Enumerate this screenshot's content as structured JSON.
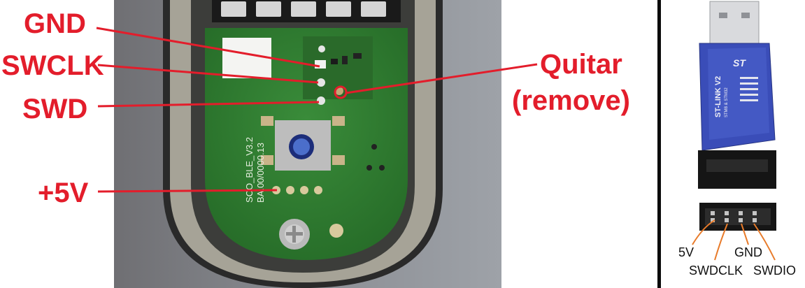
{
  "labels": {
    "gnd": "GND",
    "swclk": "SWCLK",
    "swd": "SWD",
    "quitar": "Quitar",
    "remove": "(remove)",
    "plus5v": "+5V"
  },
  "pcb_silkscreen": {
    "line1": "SCO_BLE_V3.2",
    "line2": "BA.00/0000.13"
  },
  "stlink_device": {
    "name": "ST-LINK V2",
    "subtitle": "STM8 & STM32",
    "brand": "ST"
  },
  "connector_pins": {
    "p5v": "5V",
    "swdclk": "SWDCLK",
    "gnd": "GND",
    "swdio": "SWDIO"
  },
  "colors": {
    "label_red": "#e31d2b",
    "pcb_green": "#2f7a2e",
    "wire_orange": "#e87b2a",
    "stlink_blue": "#3a4db8"
  }
}
